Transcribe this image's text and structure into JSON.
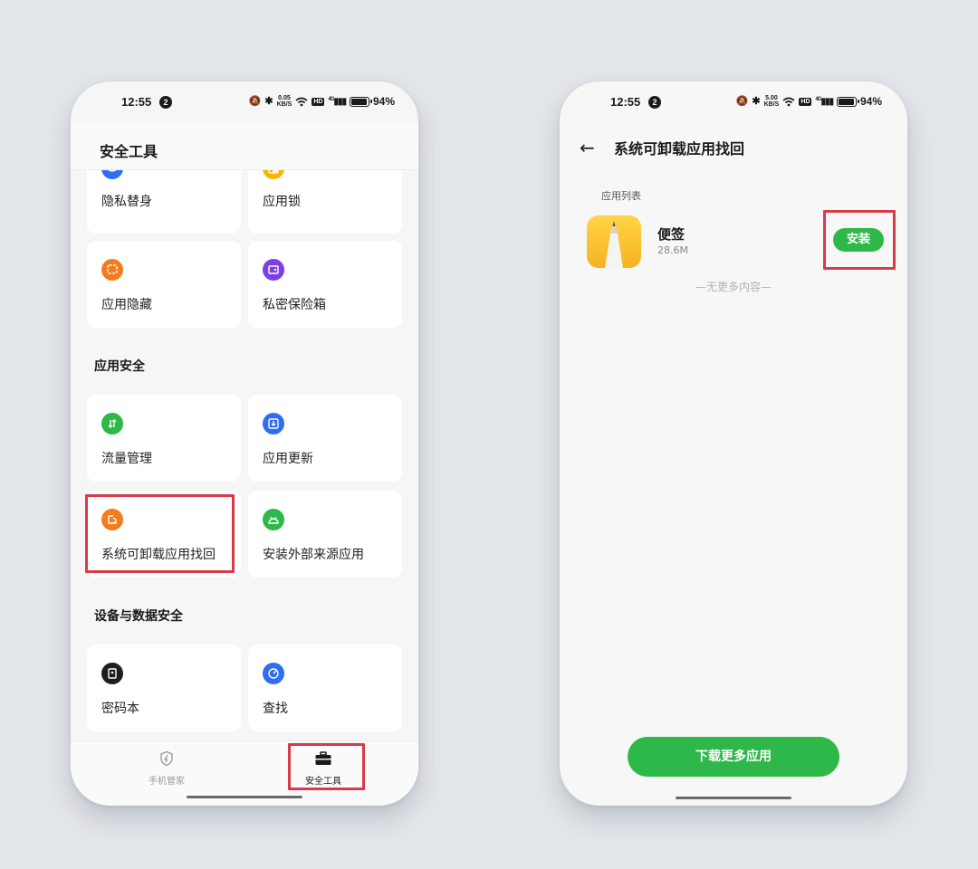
{
  "status_bar": {
    "time": "12:55",
    "notification_count": "2",
    "speed_left": "0.05",
    "speed_right": "5.00",
    "speed_unit": "KB/S",
    "hd": "HD",
    "signal": "4G",
    "battery": "94%"
  },
  "left_screen": {
    "header_title": "安全工具",
    "group1": [
      {
        "label": "隐私替身",
        "icon": "privacy-avatar-icon",
        "color": "#2f6ef0"
      },
      {
        "label": "应用锁",
        "icon": "app-lock-icon",
        "color": "#f7b500"
      },
      {
        "label": "应用隐藏",
        "icon": "app-hide-icon",
        "color": "#f47c20"
      },
      {
        "label": "私密保险箱",
        "icon": "private-safe-icon",
        "color": "#7b3fe4"
      }
    ],
    "section_app_security": "应用安全",
    "group2": [
      {
        "label": "流量管理",
        "icon": "data-traffic-icon",
        "color": "#2eb84a"
      },
      {
        "label": "应用更新",
        "icon": "app-update-icon",
        "color": "#2f6ef0"
      },
      {
        "label": "系统可卸载应用找回",
        "icon": "app-restore-icon",
        "color": "#f47c20"
      },
      {
        "label": "安装外部来源应用",
        "icon": "android-icon",
        "color": "#2eb84a"
      }
    ],
    "section_device_security": "设备与数据安全",
    "group3": [
      {
        "label": "密码本",
        "icon": "password-book-icon",
        "color": "#1e1e1e"
      },
      {
        "label": "查找",
        "icon": "find-device-icon",
        "color": "#2f6ef0"
      }
    ],
    "tabs": [
      {
        "label": "手机管家",
        "icon": "shield-icon"
      },
      {
        "label": "安全工具",
        "icon": "toolbox-icon"
      }
    ]
  },
  "right_screen": {
    "title": "系统可卸载应用找回",
    "list_caption": "应用列表",
    "app": {
      "name": "便签",
      "size": "28.6M",
      "icon": "notes-app-icon"
    },
    "install_label": "安装",
    "no_more": "—无更多内容—",
    "download_more": "下载更多应用"
  },
  "colors": {
    "accent_green": "#2eb84a",
    "highlight_red": "#d93a48"
  }
}
